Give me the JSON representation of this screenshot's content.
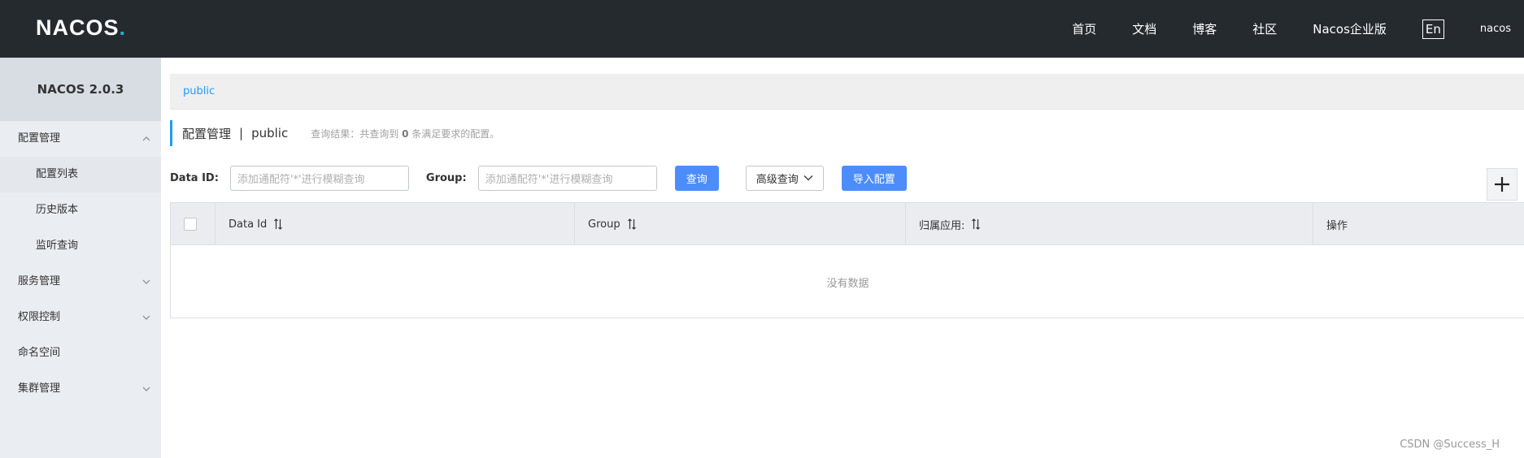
{
  "header": {
    "logo": {
      "part1": "NA",
      "part2": "C",
      "part3": "OS",
      "dot": "."
    },
    "nav": [
      "首页",
      "文档",
      "博客",
      "社区",
      "Nacos企业版"
    ],
    "lang": "En",
    "user": "nacos"
  },
  "sidebar": {
    "version": "NACOS 2.0.3",
    "items": [
      {
        "label": "配置管理",
        "icon": "chevron-up-icon"
      },
      {
        "label": "配置列表"
      },
      {
        "label": "历史版本"
      },
      {
        "label": "监听查询"
      },
      {
        "label": "服务管理",
        "icon": "chevron-down-icon"
      },
      {
        "label": "权限控制",
        "icon": "chevron-down-icon"
      },
      {
        "label": "命名空间"
      },
      {
        "label": "集群管理",
        "icon": "chevron-down-icon"
      }
    ]
  },
  "main": {
    "namespace": "public",
    "title": "配置管理",
    "title_sep": "|",
    "title_ns": "public",
    "result_prefix": "查询结果：共查询到",
    "result_count": "0",
    "result_suffix": "条满足要求的配置。",
    "search": {
      "dataid_label": "Data ID:",
      "dataid_placeholder": "添加通配符'*'进行模糊查询",
      "group_label": "Group:",
      "group_placeholder": "添加通配符'*'进行模糊查询",
      "query_button": "查询",
      "advanced_button": "高级查询",
      "import_button": "导入配置"
    },
    "table": {
      "columns": [
        "Data Id",
        "Group",
        "归属应用:",
        "操作"
      ],
      "empty": "没有数据"
    }
  },
  "watermark": "CSDN @Success_H",
  "colors": {
    "header_bg": "#252a2f",
    "sidebar_bg": "#eaedf1",
    "primary": "#4c8dfb",
    "link": "#209bfa"
  }
}
